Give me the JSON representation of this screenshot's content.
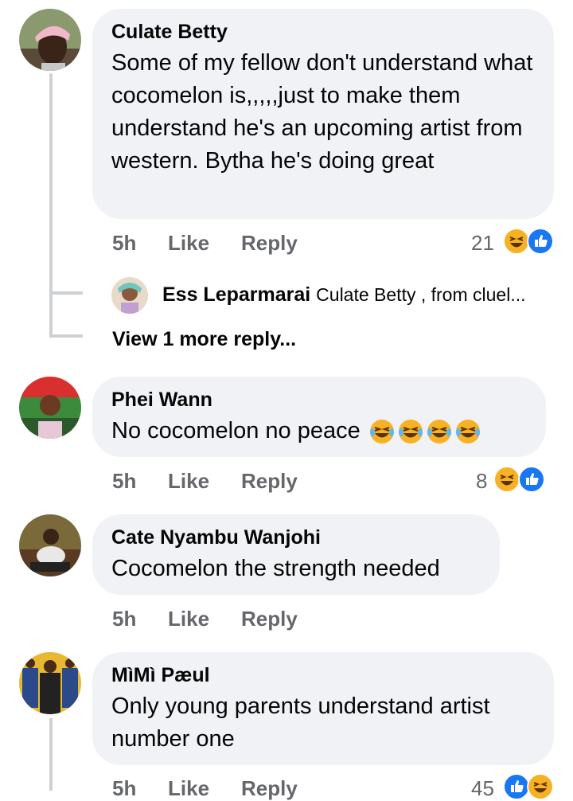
{
  "comments": [
    {
      "author": "Culate Betty",
      "text": "Some of my fellow don't understand what cocomelon is,,,,,just to make them understand he's  an upcoming artist from western. Bytha he's doing great",
      "time": "5h",
      "like": "Like",
      "reply": "Reply",
      "reaction_count": "21"
    },
    {
      "author": "Phei Wann",
      "text": "No cocomelon no peace",
      "time": "5h",
      "like": "Like",
      "reply": "Reply",
      "reaction_count": "8"
    },
    {
      "author": "Cate Nyambu Wanjohi",
      "text": "Cocomelon the strength needed",
      "time": "5h",
      "like": "Like",
      "reply": "Reply"
    },
    {
      "author": "MìMì Pæul",
      "text": "Only young parents understand artist number one",
      "time": "5h",
      "like": "Like",
      "reply": "Reply",
      "reaction_count": "45"
    }
  ],
  "reply_preview": {
    "author": "Ess Leparmarai",
    "text": "Culate Betty , from cluel..."
  },
  "view_more": "View 1 more reply...",
  "colors": {
    "bubble": "#f0f2f5",
    "meta": "#65676b",
    "like_blue": "#1877f2",
    "haha_yellow": "#f7b125"
  }
}
